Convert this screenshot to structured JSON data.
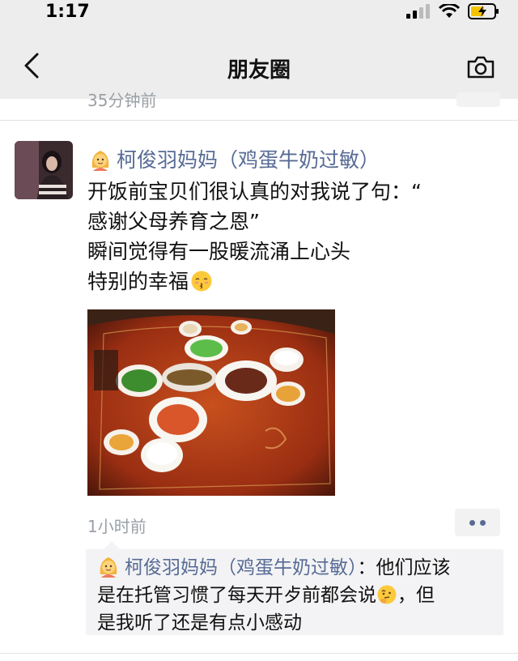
{
  "status_bar": {
    "time": "1:17"
  },
  "nav": {
    "title": "朋友圈"
  },
  "prev_post": {
    "time_ago": "35分钟前"
  },
  "post": {
    "author": "柯俊羽妈妈（鸡蛋牛奶过敏）",
    "author_emoji": "woman-emoji",
    "lines": [
      "开饭前宝贝们很认真的对我说了句：“",
      "感谢父母养育之恩”",
      "瞬间觉得有一股暖流涌上心头",
      "特别的幸福"
    ],
    "line4_emoji": "kissing-face-emoji",
    "time_ago": "1小时前"
  },
  "comment": {
    "author": "柯俊羽妈妈（鸡蛋牛奶过敏）",
    "separator": "：",
    "line1_text": "他们应该",
    "line2_text": "是在托管习惯了每天开歺前都会说",
    "line2_tail": "，但",
    "line3_text": "是我听了还是有点小感动"
  },
  "colors": {
    "link": "#576b95",
    "nav_bg": "#ededed",
    "comment_bg": "#f3f3f5",
    "meta": "#9aa0a6"
  }
}
